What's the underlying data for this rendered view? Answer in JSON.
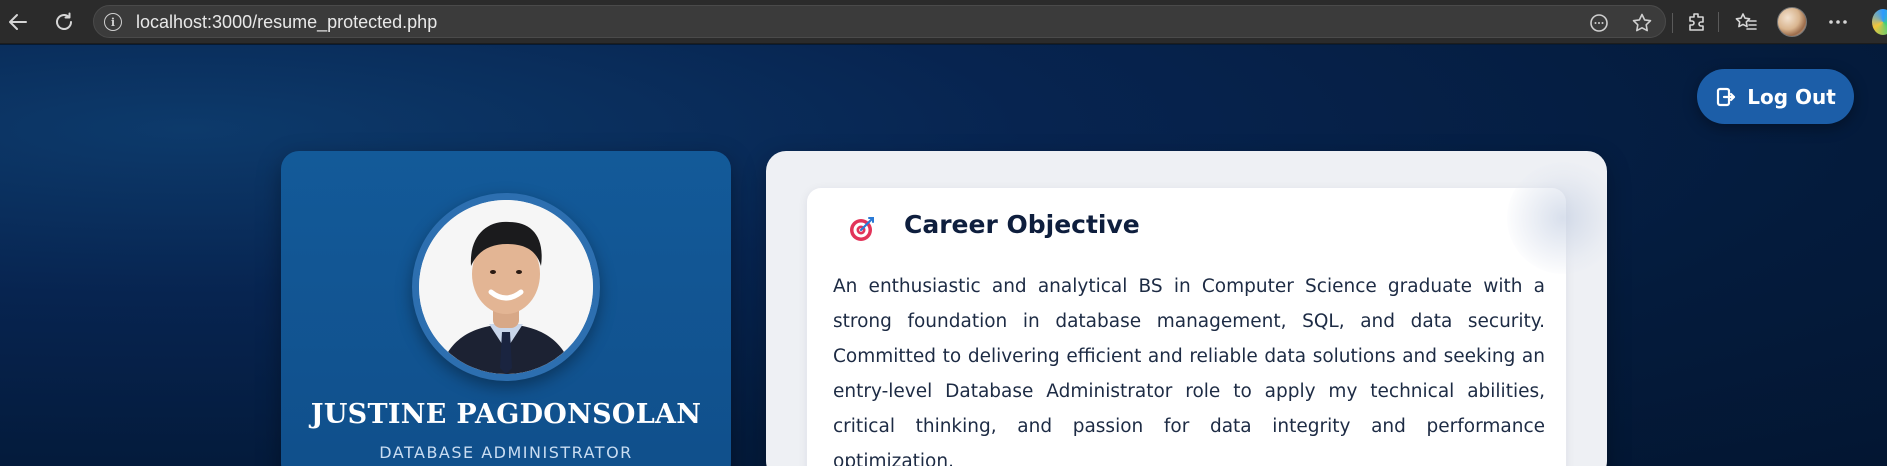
{
  "browser": {
    "url": "localhost:3000/resume_protected.php",
    "icons": {
      "back": "back-arrow-icon",
      "reload": "reload-icon",
      "site_info": "site-info-icon",
      "reading_mode": "reading-mode-icon",
      "favorite": "favorite-star-icon",
      "extensions": "extensions-icon",
      "favorites": "favorites-icon",
      "profile": "profile-avatar",
      "menu": "more-menu-icon"
    }
  },
  "header": {
    "logout_label": "Log Out"
  },
  "profile": {
    "name": "JUSTINE PAGDONSOLAN",
    "role": "DATABASE ADMINISTRATOR"
  },
  "career_objective": {
    "title": "Career Objective",
    "text": "An enthusiastic and analytical BS in Computer Science graduate with a strong foundation in database management, SQL, and data security. Committed to delivering efficient and reliable data solutions and seeking an entry-level Database Administrator role to apply my technical abilities, critical thinking, and passion for data integrity and performance optimization."
  },
  "colors": {
    "page_background": "#041b3c",
    "accent_blue": "#1c5ea8",
    "profile_card": "#135a99",
    "heading_text": "#0e1e3d"
  }
}
